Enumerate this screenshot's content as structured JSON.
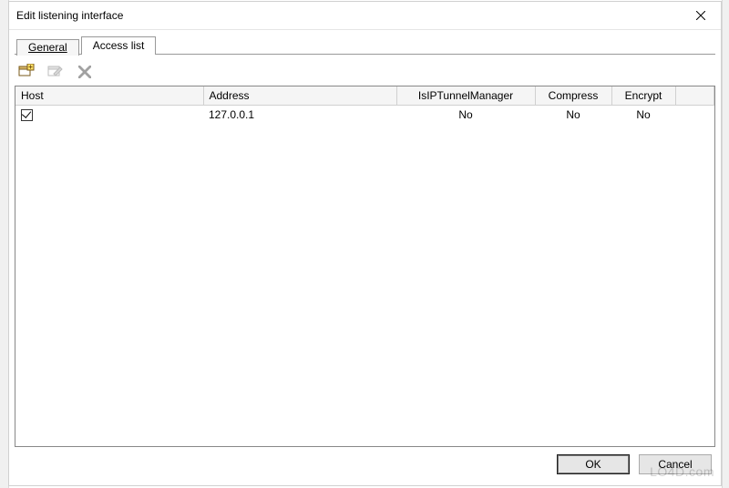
{
  "window": {
    "title": "Edit listening interface"
  },
  "tabs": {
    "general": "General",
    "access_list": "Access list"
  },
  "columns": {
    "host": "Host",
    "address": "Address",
    "istunnel": "IsIPTunnelManager",
    "compress": "Compress",
    "encrypt": "Encrypt"
  },
  "rows": [
    {
      "host_checked": true,
      "address": "127.0.0.1",
      "istunnel": "No",
      "compress": "No",
      "encrypt": "No"
    }
  ],
  "buttons": {
    "ok": "OK",
    "cancel": "Cancel"
  },
  "watermark": "LO4D.com"
}
